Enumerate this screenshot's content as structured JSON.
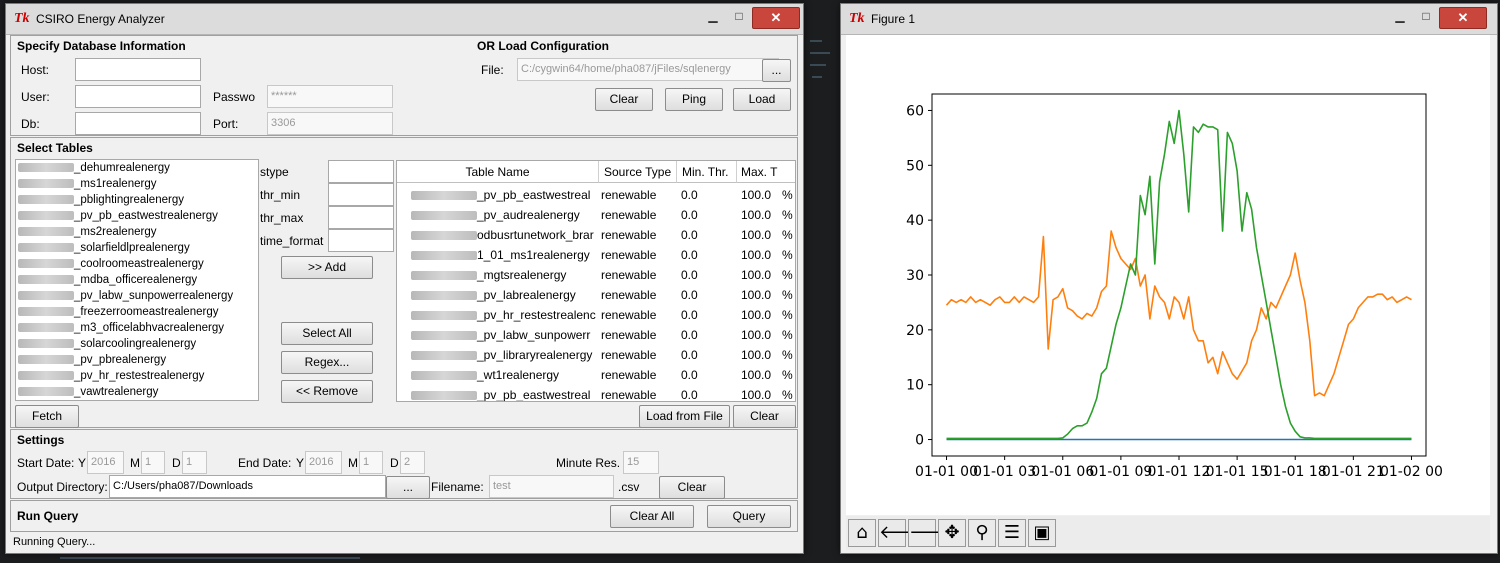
{
  "analyzer": {
    "title": "CSIRO Energy Analyzer",
    "tk_logo": "Tk",
    "db_section_title": "Specify Database Information",
    "host_label": "Host:",
    "user_label": "User:",
    "db_label": "Db:",
    "password_label": "Passwo",
    "password_value": "******",
    "port_label": "Port:",
    "port_value": "3306",
    "config_section_title": "OR Load Configuration",
    "file_label": "File:",
    "file_value": "C:/cygwin64/home/pha087/jFiles/sqlenergy",
    "browse_label": "...",
    "clear_label": "Clear",
    "ping_label": "Ping",
    "load_label": "Load",
    "tables_section_title": "Select Tables",
    "table_list": [
      "_dehumrealenergy",
      "_ms1realenergy",
      "_pblightingrealenergy",
      "_pv_pb_eastwestrealenergy",
      "_ms2realenergy",
      "_solarfieldlprealenergy",
      "_coolroomeastrealenergy",
      "_mdba_officerealenergy",
      "_pv_labw_sunpowerrealenergy",
      "_freezerroomeastrealenergy",
      "_m3_officelabhvacrealenergy",
      "_solarcoolingrealenergy",
      "_pv_pbrealenergy",
      "_pv_hr_restestrealenergy",
      "_vawtrealenergy"
    ],
    "stype_label": "stype",
    "thr_min_label": "thr_min",
    "thr_max_label": "thr_max",
    "time_format_label": "time_format",
    "add_label": ">> Add",
    "select_all_label": "Select All",
    "regex_label": "Regex...",
    "remove_label": "<< Remove",
    "fetch_label": "Fetch",
    "table_headers": [
      "Table Name",
      "Source Type",
      "Min. Thr.",
      "Max. T"
    ],
    "selected_rows": [
      {
        "name": "_pv_pb_eastwestreal",
        "type": "renewable",
        "min": "0.0",
        "max": "100.0",
        "fmt": "%"
      },
      {
        "name": "_pv_audrealenergy",
        "type": "renewable",
        "min": "0.0",
        "max": "100.0",
        "fmt": "%"
      },
      {
        "name": "odbusrtunetwork_brar",
        "type": "renewable",
        "min": "0.0",
        "max": "100.0",
        "fmt": "%"
      },
      {
        "name": "1_01_ms1realenergy",
        "type": "renewable",
        "min": "0.0",
        "max": "100.0",
        "fmt": "%"
      },
      {
        "name": "_mgtsrealenergy",
        "type": "renewable",
        "min": "0.0",
        "max": "100.0",
        "fmt": "%"
      },
      {
        "name": "_pv_labrealenergy",
        "type": "renewable",
        "min": "0.0",
        "max": "100.0",
        "fmt": "%"
      },
      {
        "name": "_pv_hr_restestrealenc",
        "type": "renewable",
        "min": "0.0",
        "max": "100.0",
        "fmt": "%"
      },
      {
        "name": "_pv_labw_sunpowerr",
        "type": "renewable",
        "min": "0.0",
        "max": "100.0",
        "fmt": "%"
      },
      {
        "name": "_pv_libraryrealenergy",
        "type": "renewable",
        "min": "0.0",
        "max": "100.0",
        "fmt": "%"
      },
      {
        "name": "_wt1realenergy",
        "type": "renewable",
        "min": "0.0",
        "max": "100.0",
        "fmt": "%"
      },
      {
        "name": "_pv_pb_eastwestreal",
        "type": "renewable",
        "min": "0.0",
        "max": "100.0",
        "fmt": "%"
      }
    ],
    "load_from_file_label": "Load from File",
    "clear_table_label": "Clear",
    "settings_title": "Settings",
    "start_date_label": "Start Date:",
    "y_label": "Y",
    "m_label": "M",
    "d_label": "D",
    "start_year": "2016",
    "start_month": "1",
    "start_day": "1",
    "end_date_label": "End Date:",
    "end_year": "2016",
    "end_month": "1",
    "end_day": "2",
    "minute_res_label": "Minute Res.",
    "minute_res_value": "15",
    "output_dir_label": "Output Directory:",
    "output_dir_value": "C:/Users/pha087/Downloads",
    "filename_label": "Filename:",
    "filename_value": "test",
    "csv_suffix": ".csv",
    "clear_settings_label": "Clear",
    "run_query_title": "Run Query",
    "clear_all_label": "Clear All",
    "query_label": "Query",
    "status_text": "Running Query..."
  },
  "figure": {
    "title": "Figure 1",
    "tk_logo": "Tk",
    "toolbar": [
      "home-icon",
      "back-icon",
      "forward-icon",
      "pan-icon",
      "zoom-icon",
      "configure-icon",
      "save-icon"
    ]
  },
  "window_buttons": {
    "minimize": "▁",
    "maximize": "□",
    "close": "✕"
  },
  "chart_data": {
    "type": "line",
    "title": "",
    "xlabel": "",
    "ylabel": "",
    "x_tick_labels": [
      "01-01 00",
      "01-01 03",
      "01-01 06",
      "01-01 09",
      "01-01 12",
      "01-01 15",
      "01-01 18",
      "01-01 21",
      "01-02 00"
    ],
    "x_tick_hours": [
      0,
      3,
      6,
      9,
      12,
      15,
      18,
      21,
      24
    ],
    "y_ticks": [
      0,
      10,
      20,
      30,
      40,
      50,
      60
    ],
    "xlim_hours": [
      -0.75,
      24.75
    ],
    "ylim": [
      -3,
      63
    ],
    "colors": {
      "blue": "#1f77b4",
      "orange": "#ff7f0e",
      "green": "#2ca02c"
    },
    "series": [
      {
        "color": "blue",
        "x_hours": [
          0,
          24
        ],
        "values": [
          0,
          0
        ]
      },
      {
        "color": "orange",
        "x_hours": [
          0,
          0.25,
          0.5,
          0.75,
          1,
          1.25,
          1.5,
          1.75,
          2,
          2.25,
          2.5,
          2.75,
          3,
          3.25,
          3.5,
          3.75,
          4,
          4.25,
          4.5,
          4.75,
          5,
          5.25,
          5.5,
          5.75,
          6,
          6.25,
          6.5,
          6.75,
          7,
          7.25,
          7.5,
          7.75,
          8,
          8.25,
          8.5,
          8.75,
          9,
          9.25,
          9.5,
          9.75,
          10,
          10.25,
          10.5,
          10.75,
          11,
          11.25,
          11.5,
          11.75,
          12,
          12.25,
          12.5,
          12.75,
          13,
          13.25,
          13.5,
          13.75,
          14,
          14.25,
          14.5,
          14.75,
          15,
          15.25,
          15.5,
          15.75,
          16,
          16.25,
          16.5,
          16.75,
          17,
          17.25,
          17.5,
          17.75,
          18,
          18.25,
          18.5,
          18.75,
          19,
          19.25,
          19.5,
          19.75,
          20,
          20.25,
          20.5,
          20.75,
          21,
          21.25,
          21.5,
          21.75,
          22,
          22.25,
          22.5,
          22.75,
          23,
          23.25,
          23.5,
          23.75,
          24
        ],
        "values": [
          24.5,
          25.5,
          25,
          25.5,
          25,
          26,
          25,
          25.5,
          25,
          24.5,
          25.5,
          26,
          25,
          25,
          26,
          25,
          26,
          25.5,
          25,
          26,
          37,
          16.5,
          25.5,
          26,
          27.5,
          24,
          23.5,
          22.5,
          22,
          23,
          22.5,
          24,
          27,
          28,
          38,
          35,
          33,
          32,
          31,
          33,
          28,
          30,
          22,
          28,
          26,
          25,
          22,
          26,
          25,
          22,
          26,
          20,
          18,
          18,
          14,
          15,
          12,
          16,
          14,
          12,
          11,
          12.5,
          14,
          18,
          20,
          24,
          22,
          25,
          24,
          26,
          28,
          30,
          34,
          29,
          25,
          18,
          8,
          8.5,
          8,
          10,
          12,
          15,
          18,
          21,
          22,
          24,
          25,
          26,
          26,
          26.5,
          26.5,
          25.5,
          26,
          25,
          25.5,
          26,
          25.5,
          25.5,
          25.5,
          26
        ]
      },
      {
        "color": "green",
        "x_hours": [
          0,
          0.25,
          0.5,
          0.75,
          1,
          1.25,
          1.5,
          1.75,
          2,
          2.25,
          2.5,
          2.75,
          3,
          3.25,
          3.5,
          3.75,
          4,
          4.25,
          4.5,
          4.75,
          5,
          5.25,
          5.5,
          5.75,
          6,
          6.25,
          6.5,
          6.75,
          7,
          7.25,
          7.5,
          7.75,
          8,
          8.25,
          8.5,
          8.75,
          9,
          9.25,
          9.5,
          9.75,
          10,
          10.25,
          10.5,
          10.75,
          11,
          11.25,
          11.5,
          11.75,
          12,
          12.25,
          12.5,
          12.75,
          13,
          13.25,
          13.5,
          13.75,
          14,
          14.25,
          14.5,
          14.75,
          15,
          15.25,
          15.5,
          15.75,
          16,
          16.25,
          16.5,
          16.75,
          17,
          17.25,
          17.5,
          17.75,
          18,
          18.25,
          18.5,
          18.75,
          19,
          19.25,
          19.5,
          19.75,
          20,
          20.25,
          20.5,
          20.75,
          21,
          21.25,
          21.5,
          21.75,
          22,
          22.25,
          22.5,
          22.75,
          23,
          23.25,
          23.5,
          23.75,
          24
        ],
        "values": [
          0.2,
          0.2,
          0.2,
          0.2,
          0.2,
          0.2,
          0.2,
          0.2,
          0.2,
          0.2,
          0.2,
          0.2,
          0.2,
          0.2,
          0.2,
          0.2,
          0.2,
          0.2,
          0.2,
          0.2,
          0.2,
          0.2,
          0.2,
          0.2,
          0.3,
          1,
          2,
          2.5,
          2.5,
          3,
          5,
          7.5,
          12,
          13,
          17,
          21,
          24,
          28,
          32,
          30,
          44.5,
          41,
          48,
          32,
          47,
          52,
          58,
          54,
          60,
          52,
          41.5,
          57,
          56,
          57.5,
          57,
          57,
          56.5,
          38,
          56,
          54,
          49,
          38,
          45,
          42,
          35,
          30,
          25,
          20,
          15,
          10,
          6,
          3,
          1.5,
          0.5,
          0.3,
          0.3,
          0.2,
          0.2,
          0.2,
          0.2,
          0.2,
          0.2,
          0.2,
          0.2,
          0.2,
          0.2,
          0.2,
          0.2,
          0.2,
          0.2,
          0.2,
          0.2,
          0.2,
          0.2,
          0.2,
          0.2,
          0.2,
          0.2,
          0.2,
          0.2,
          0.2
        ]
      }
    ]
  }
}
